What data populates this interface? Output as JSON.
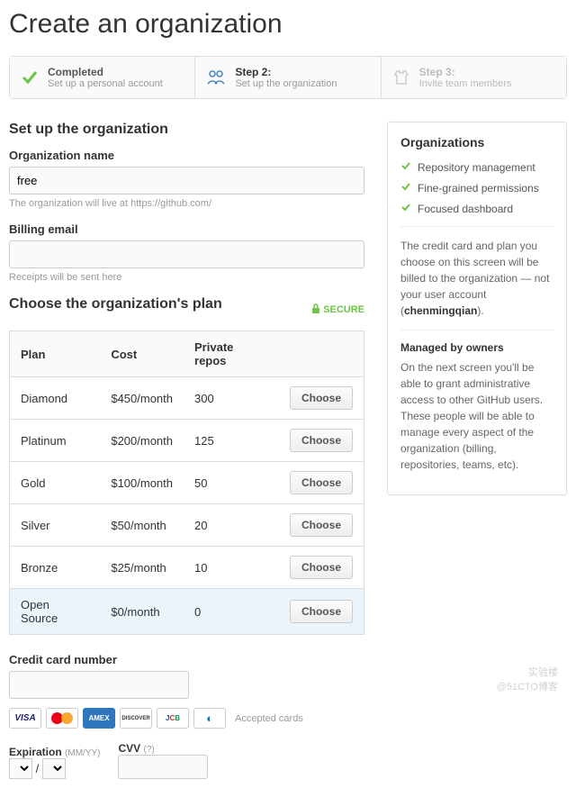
{
  "title": "Create an organization",
  "steps": [
    {
      "title": "Completed",
      "sub": "Set up a personal account",
      "icon": "check"
    },
    {
      "title": "Step 2:",
      "sub": "Set up the organization",
      "icon": "org"
    },
    {
      "title": "Step 3:",
      "sub": "Invite team members",
      "icon": "invite"
    }
  ],
  "form": {
    "heading": "Set up the organization",
    "name_label": "Organization name",
    "name_value": "free",
    "name_hint": "The organization will live at https://github.com/",
    "email_label": "Billing email",
    "email_value": "",
    "email_hint": "Receipts will be sent here"
  },
  "plans": {
    "heading": "Choose the organization's plan",
    "secure": "SECURE",
    "cols": [
      "Plan",
      "Cost",
      "Private repos",
      ""
    ],
    "rows": [
      {
        "name": "Diamond",
        "cost": "$450/month",
        "repos": "300",
        "selected": false
      },
      {
        "name": "Platinum",
        "cost": "$200/month",
        "repos": "125",
        "selected": false
      },
      {
        "name": "Gold",
        "cost": "$100/month",
        "repos": "50",
        "selected": false
      },
      {
        "name": "Silver",
        "cost": "$50/month",
        "repos": "20",
        "selected": false
      },
      {
        "name": "Bronze",
        "cost": "$25/month",
        "repos": "10",
        "selected": false
      },
      {
        "name": "Open Source",
        "cost": "$0/month",
        "repos": "0",
        "selected": true
      }
    ],
    "choose": "Choose"
  },
  "sidebar": {
    "title": "Organizations",
    "features": [
      "Repository management",
      "Fine-grained permissions",
      "Focused dashboard"
    ],
    "note1_pre": "The credit card and plan you choose on this screen will be billed to the organization — not your user account (",
    "note1_user": "chenmingqian",
    "note1_post": ").",
    "managed_title": "Managed by owners",
    "managed_text": "On the next screen you'll be able to grant administrative access to other GitHub users. These people will be able to manage every aspect of the organization (billing, repositories, teams, etc)."
  },
  "payment": {
    "cc_label": "Credit card number",
    "accepted": "Accepted cards",
    "exp_label": "Expiration",
    "exp_hint": "(MM/YY)",
    "cvv_label": "CVV",
    "cvv_hint": "(?)"
  },
  "watermark": {
    "line1": "实验楼",
    "line2": "@51CTO博客"
  }
}
